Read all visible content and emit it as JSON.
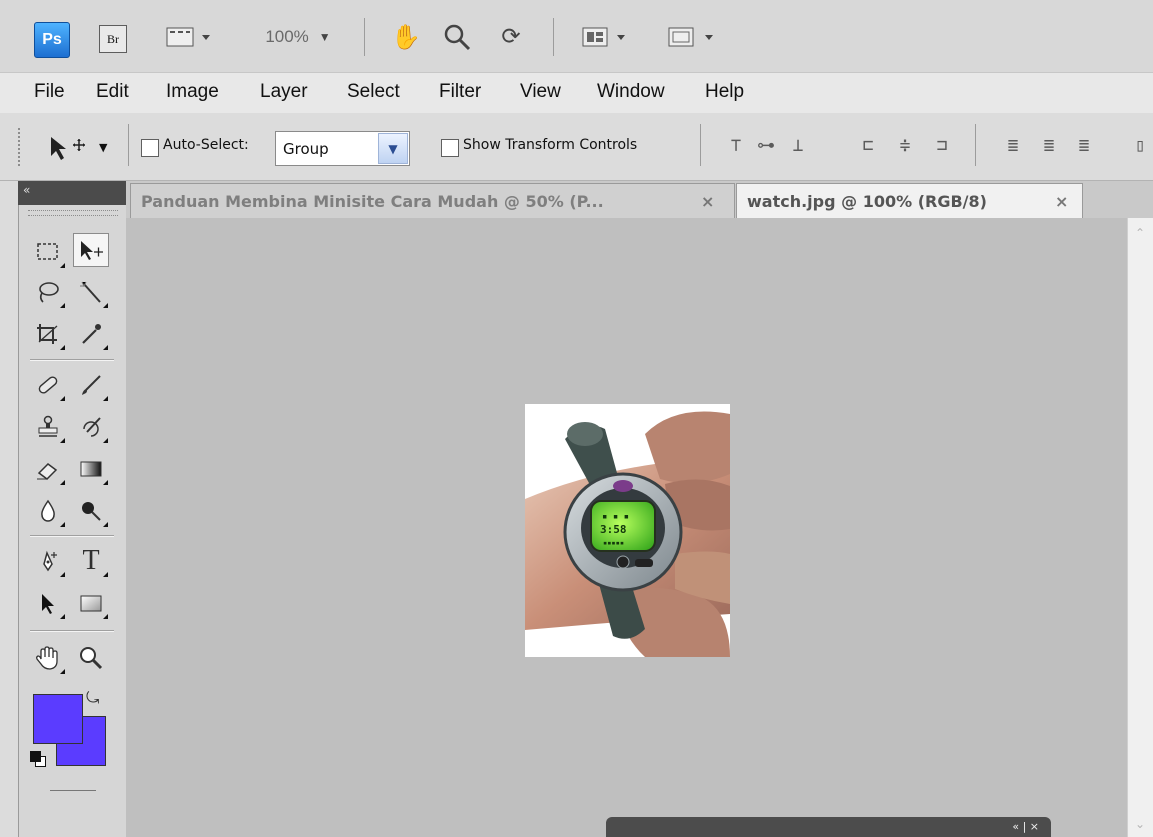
{
  "app_bar": {
    "ps_label": "Ps",
    "br_label": "Br",
    "zoom": "100%",
    "icons": [
      "screen-mode-icon",
      "hand-icon",
      "zoom-icon",
      "rotate-view-icon",
      "arrange-documents-icon",
      "screen-mode-icon"
    ]
  },
  "menu": {
    "items": [
      "File",
      "Edit",
      "Image",
      "Layer",
      "Select",
      "Filter",
      "View",
      "Window",
      "Help"
    ]
  },
  "options": {
    "auto_select_label": "Auto-Select:",
    "auto_select_value": "Group",
    "show_transform_label": "Show Transform Controls"
  },
  "tabs": [
    {
      "label": "Panduan Membina Minisite Cara Mudah @ 50% (P...",
      "close": "×"
    },
    {
      "label": "watch.jpg @ 100% (RGB/8)",
      "close": "×"
    }
  ],
  "tools_header": "«",
  "tools": {
    "type_tool": "T"
  },
  "colors": {
    "foreground": "#5b3cff",
    "background": "#5b3cff"
  },
  "float_panel": {
    "controls": "« | ×"
  }
}
